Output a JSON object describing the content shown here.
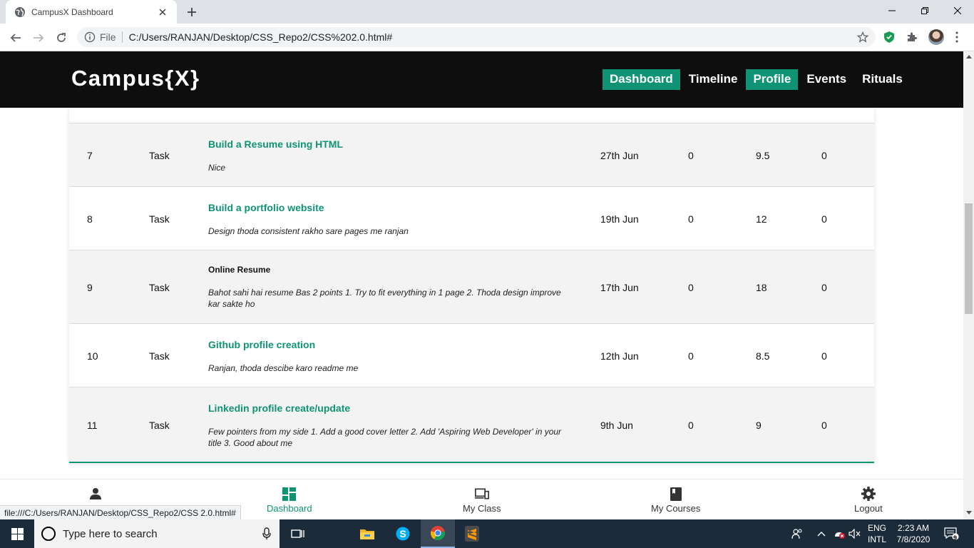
{
  "browser": {
    "tab_title": "CampusX Dashboard",
    "omnibox_scheme": "File",
    "url": "C:/Users/RANJAN/Desktop/CSS_Repo2/CSS%202.0.html#",
    "status_url": "file:///C:/Users/RANJAN/Desktop/CSS_Repo2/CSS 2.0.html#"
  },
  "site": {
    "logo": "Campus{X}",
    "nav": [
      {
        "label": "Dashboard",
        "active": true
      },
      {
        "label": "Timeline",
        "active": false
      },
      {
        "label": "Profile",
        "active": true
      },
      {
        "label": "Events",
        "active": false
      },
      {
        "label": "Rituals",
        "active": false
      }
    ]
  },
  "table": {
    "rows": [
      {
        "num": "7",
        "type": "Task",
        "title": "Build a Resume using HTML",
        "title_link": true,
        "comment": "Nice",
        "date": "27th Jun",
        "s1": "0",
        "s2": "9.5",
        "s3": "0"
      },
      {
        "num": "8",
        "type": "Task",
        "title": "Build a portfolio website",
        "title_link": true,
        "comment": "Design thoda consistent rakho sare pages me ranjan",
        "date": "19th Jun",
        "s1": "0",
        "s2": "12",
        "s3": "0"
      },
      {
        "num": "9",
        "type": "Task",
        "title": "Online Resume",
        "title_link": false,
        "comment": "Bahot sahi hai resume Bas 2 points 1. Try to fit everything in 1 page 2. Thoda design improve kar sakte ho",
        "date": "17th Jun",
        "s1": "0",
        "s2": "18",
        "s3": "0"
      },
      {
        "num": "10",
        "type": "Task",
        "title": "Github profile creation",
        "title_link": true,
        "comment": "Ranjan, thoda descibe karo readme me",
        "date": "12th Jun",
        "s1": "0",
        "s2": "8.5",
        "s3": "0"
      },
      {
        "num": "11",
        "type": "Task",
        "title": "Linkedin profile create/update",
        "title_link": true,
        "comment": "Few pointers from my side 1. Add a good cover letter 2. Add 'Aspiring Web Developer' in your title 3. Good about me",
        "date": "9th Jun",
        "s1": "0",
        "s2": "9",
        "s3": "0"
      }
    ]
  },
  "bottom_nav": {
    "dashboard": "Dashboard",
    "my_class": "My Class",
    "my_courses": "My Courses",
    "logout": "Logout"
  },
  "taskbar": {
    "search_placeholder": "Type here to search",
    "lang_top": "ENG",
    "lang_bottom": "INTL",
    "time": "2:23 AM",
    "date": "7/8/2020",
    "notification_count": "9"
  },
  "colors": {
    "accent": "#0e9474",
    "header_bg": "#0e0e0e",
    "taskbar_bg": "#1c2b3a"
  }
}
